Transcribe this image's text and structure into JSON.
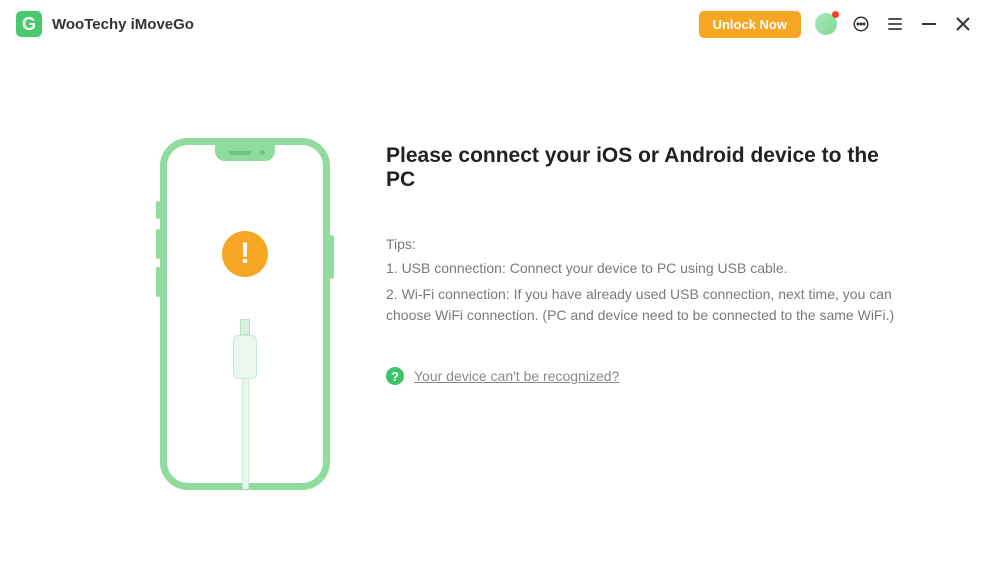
{
  "titlebar": {
    "app_name": "WooTechy iMoveGo",
    "logo_letter": "G",
    "unlock_label": "Unlock Now"
  },
  "main": {
    "headline": "Please connect your iOS or Android device to the PC",
    "tips_label": "Tips:",
    "tip1": "1. USB connection: Connect your device to PC using USB cable.",
    "tip2": "2. Wi-Fi connection: If you have already used USB connection, next time, you can choose WiFi connection. (PC and device need to be connected to the same WiFi.)",
    "help_link": "Your device can't be recognized?"
  },
  "icons": {
    "warn_glyph": "!",
    "help_glyph": "?"
  },
  "colors": {
    "accent_green": "#4ac96d",
    "accent_orange": "#f5a623"
  }
}
